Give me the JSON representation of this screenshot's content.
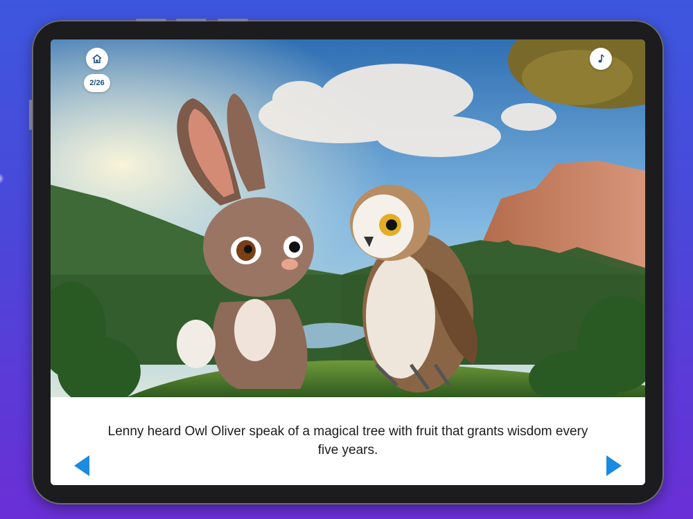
{
  "header": {
    "page_indicator": "2/26"
  },
  "icons": {
    "home": "home-icon",
    "music": "music-note-icon",
    "prev": "triangle-left-icon",
    "next": "triangle-right-icon"
  },
  "story": {
    "text": "Lenny heard Owl Oliver speak of a magical tree with fruit that grants wisdom every five years."
  },
  "colors": {
    "background_top": "#3d57de",
    "background_bottom": "#6a2fd6",
    "nav_arrow": "#1a8be0",
    "badge_text": "#1f4f7f"
  }
}
